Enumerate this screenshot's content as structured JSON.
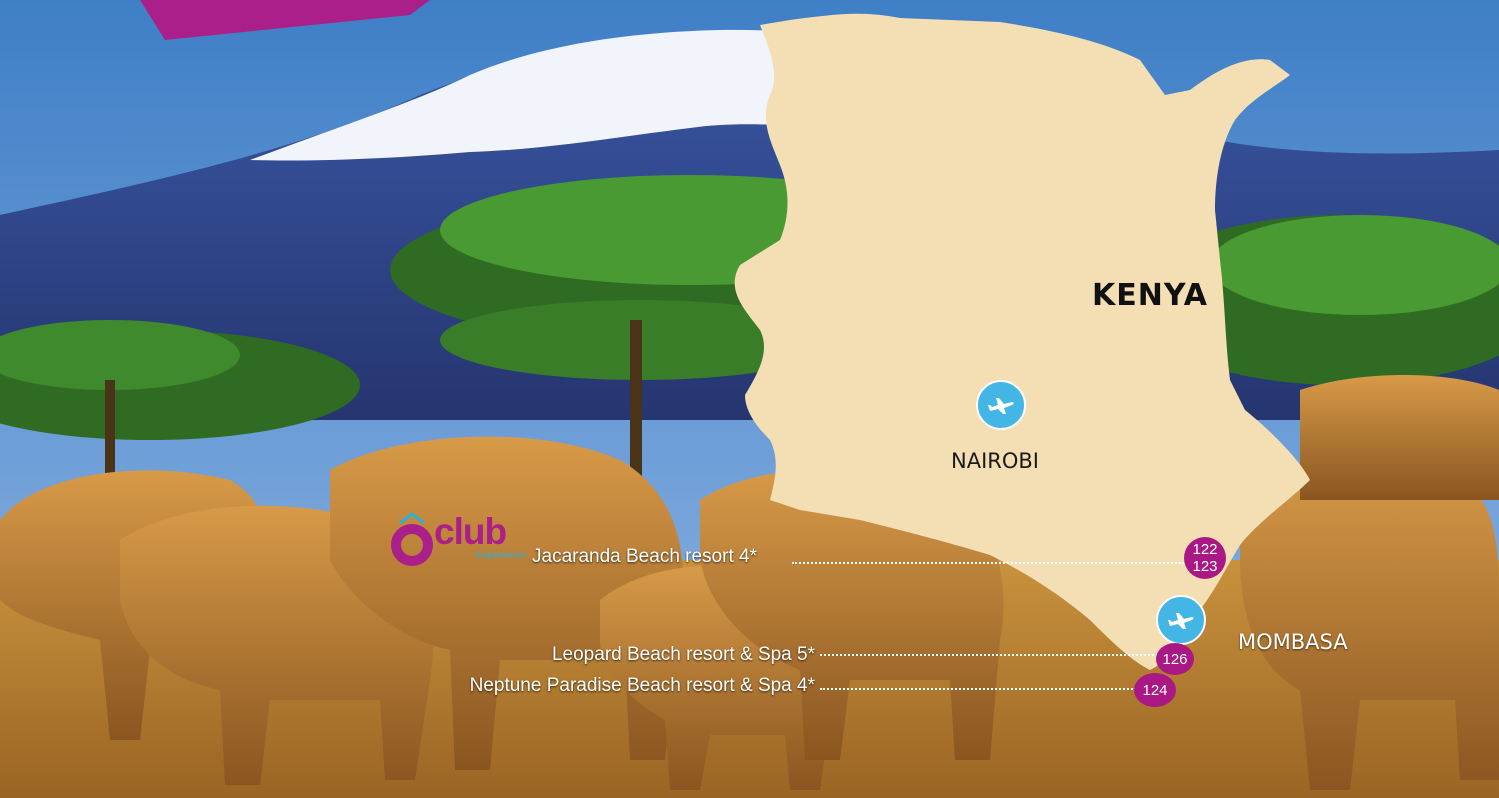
{
  "map": {
    "country": "KENYA",
    "colors": {
      "land": "#f4dfb5",
      "sky": "#4e86c8",
      "airport": "#44b6e6",
      "hotel_badge": "#a91884",
      "club_brand": "#ab1f8a"
    },
    "cities": [
      {
        "name": "NAIROBI",
        "icon": "airplane-icon"
      },
      {
        "name": "MOMBASA",
        "icon": "airplane-icon"
      }
    ],
    "hotels": [
      {
        "name": "Jacaranda Beach resort 4*",
        "pages": [
          "122",
          "123"
        ]
      },
      {
        "name": "Leopard Beach resort & Spa 5*",
        "pages": [
          "126"
        ]
      },
      {
        "name": "Neptune Paradise Beach resort & Spa 4*",
        "pages": [
          "124"
        ]
      }
    ],
    "club_logo": {
      "word": "club",
      "sub": "Experience"
    }
  }
}
